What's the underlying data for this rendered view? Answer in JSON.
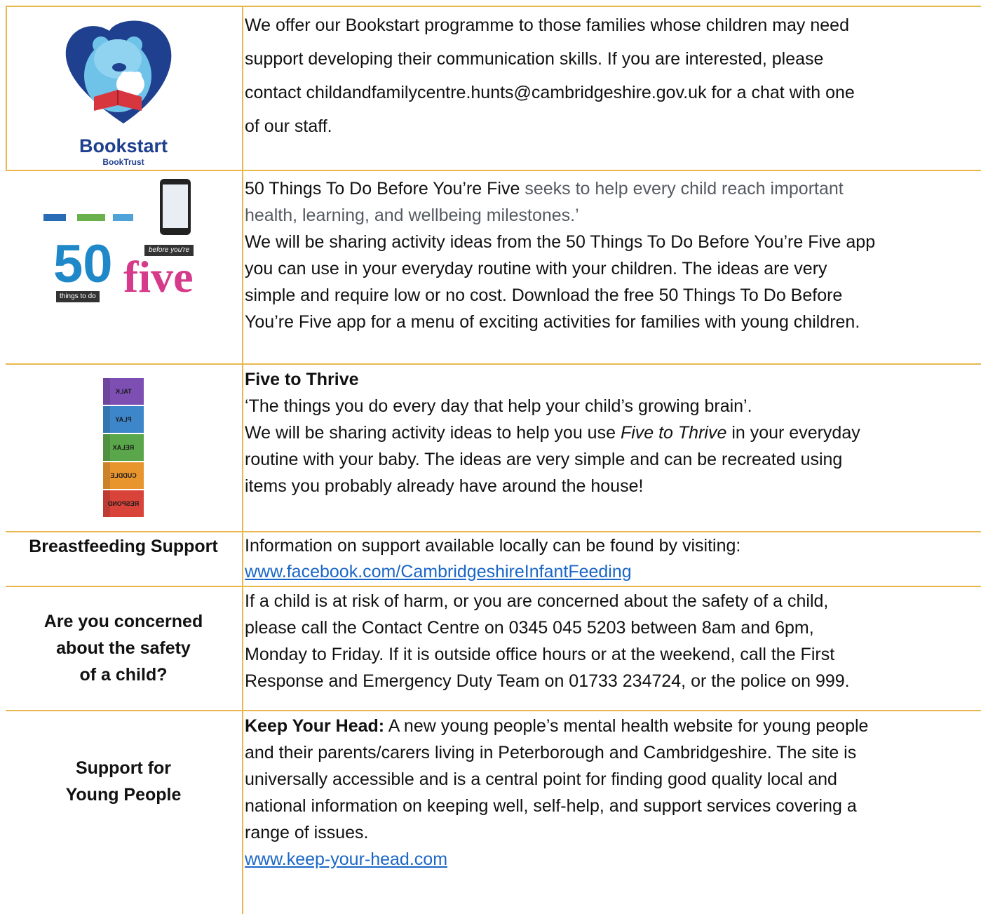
{
  "rows": {
    "bookstart": {
      "logo": {
        "title": "Bookstart",
        "sub": "BookTrust"
      },
      "text": [
        "We offer our Bookstart programme to those families whose children may need",
        "support developing their communication skills. If you are interested, please",
        "contact childandfamilycentre.hunts@cambridgeshire.gov.uk for a chat with one",
        "of our staff."
      ]
    },
    "fifty": {
      "logo": {
        "big": "50",
        "small": "things to do",
        "tag": "before you're",
        "five": "five"
      },
      "lead": "50 Things To Do Before You’re Five",
      "lead_rest": " seeks to help every child reach important",
      "line2": "health, learning, and wellbeing milestones.’",
      "text": [
        "We will be sharing activity ideas from the 50 Things To Do Before You’re Five app",
        "you can use in your everyday routine with your children. The ideas are very",
        "simple and require low or no cost. Download the free 50 Things To Do Before",
        "You’re Five app for a menu of exciting activities for families with young children."
      ]
    },
    "thrive": {
      "blocks": [
        "TALK",
        "PLAY",
        "RELAX",
        "CUDDLE",
        "RESPOND"
      ],
      "colors": [
        "#7d4fb3",
        "#3d86c9",
        "#5aa64a",
        "#e8952e",
        "#d8443a"
      ],
      "heading": "Five to Thrive",
      "quote": "‘The things you do every day that help your child’s growing brain’.",
      "line3_pre": " We will be sharing activity ideas to help you use ",
      "line3_em": "Five to Thrive",
      "line3_post": " in your everyday",
      "text": [
        "routine with your baby. The ideas are very simple and can be recreated using",
        "items you probably already have around the house!"
      ]
    },
    "breastfeeding": {
      "label": "Breastfeeding Support",
      "text": "Information on support available locally can be found by visiting:",
      "link": "www.facebook.com/CambridgeshireInfantFeeding"
    },
    "safety": {
      "label": [
        "Are you concerned",
        "about the safety",
        "of a child?"
      ],
      "text": [
        "If a child is at risk of harm, or you are concerned about the safety of a child,",
        "please call the Contact Centre on 0345 045 5203 between 8am and 6pm,",
        "Monday to Friday. If it is outside office hours or at the weekend, call the First",
        "Response and Emergency Duty Team on 01733 234724, or the police on 999."
      ]
    },
    "young": {
      "label": [
        "Support for",
        "Young People"
      ],
      "bold": "Keep Your Head:",
      "first_rest": " A new young people’s mental health website for young people",
      "text": [
        "and their parents/carers living in Peterborough and Cambridgeshire. The site is",
        "universally accessible and is a central point for finding good quality local and",
        "national information on keeping well, self-help, and support services covering a",
        "range of issues."
      ],
      "link": "www.keep-your-head.com"
    }
  }
}
